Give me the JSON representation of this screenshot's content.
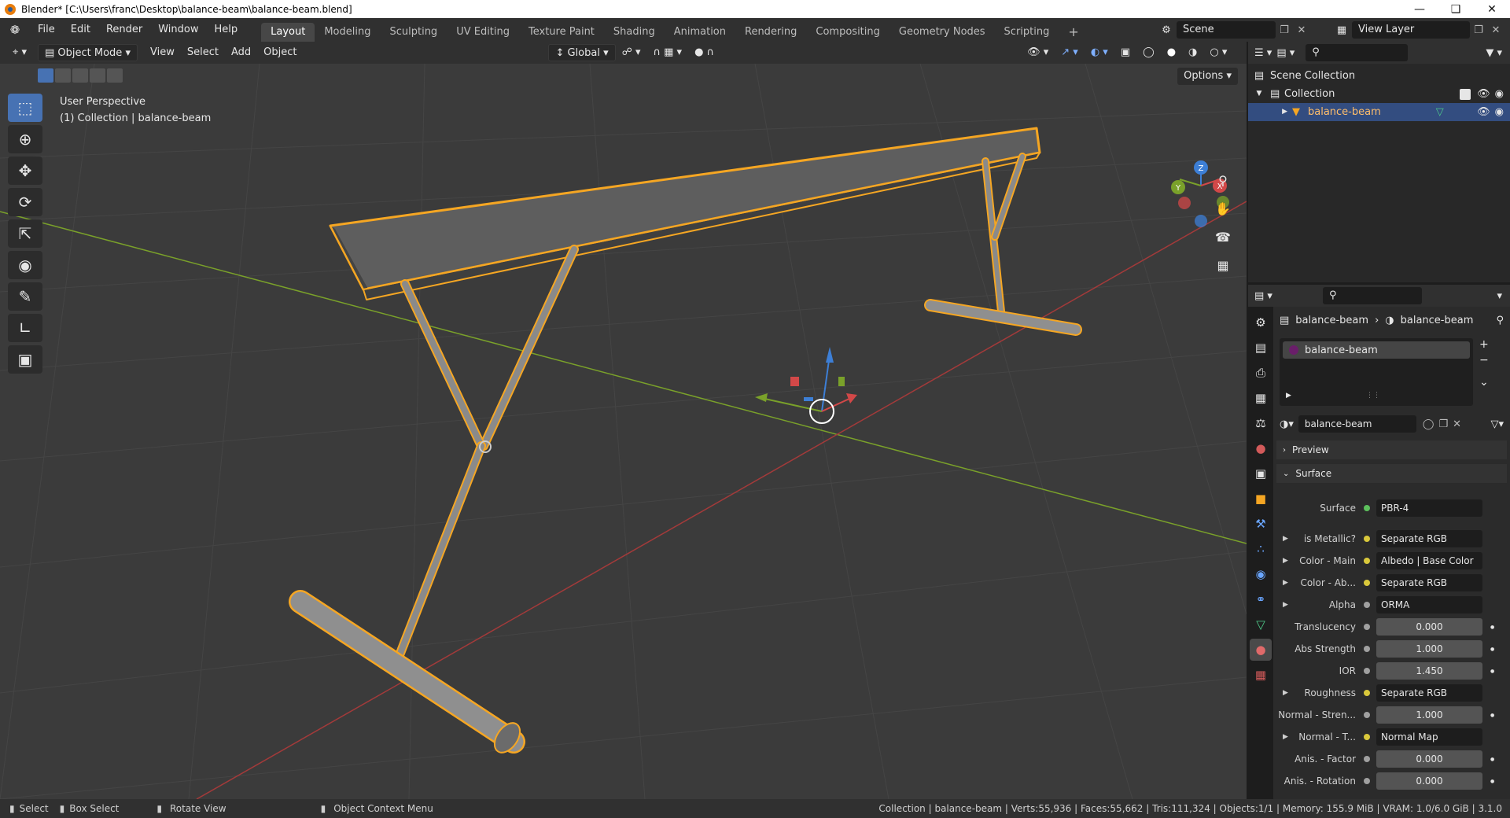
{
  "titlebar": {
    "title": "Blender* [C:\\Users\\franc\\Desktop\\balance-beam\\balance-beam.blend]"
  },
  "menus": [
    "File",
    "Edit",
    "Render",
    "Window",
    "Help"
  ],
  "workspaces": [
    "Layout",
    "Modeling",
    "Sculpting",
    "UV Editing",
    "Texture Paint",
    "Shading",
    "Animation",
    "Rendering",
    "Compositing",
    "Geometry Nodes",
    "Scripting"
  ],
  "scene": {
    "label": "Scene"
  },
  "view_layer": {
    "label": "View Layer"
  },
  "viewport_header": {
    "mode": "Object Mode",
    "menus": [
      "View",
      "Select",
      "Add",
      "Object"
    ],
    "transform_orientation": "Global"
  },
  "viewport": {
    "perspective_label": "User Perspective",
    "collection_label": "(1) Collection | balance-beam",
    "options_label": "Options",
    "gizmo_axes": [
      "X",
      "Y",
      "Z"
    ],
    "accent": "#f5a623"
  },
  "outliner": {
    "rows": [
      {
        "label": "Scene Collection"
      },
      {
        "label": "Collection"
      },
      {
        "label": "balance-beam"
      }
    ]
  },
  "properties": {
    "breadcrumb_object": "balance-beam",
    "breadcrumb_material": "balance-beam",
    "material_slot": "balance-beam",
    "material_name": "balance-beam",
    "panel_preview": "Preview",
    "panel_surface": "Surface",
    "rows": [
      {
        "label": "Surface",
        "value": "PBR-4",
        "socket": "#5cc05c",
        "type": "link"
      },
      {
        "label": "is Metallic?",
        "value": "Separate RGB",
        "socket": "#d9c83b",
        "type": "link"
      },
      {
        "label": "Color - Main",
        "value": "Albedo | Base Color",
        "socket": "#d9c83b",
        "type": "link"
      },
      {
        "label": "Color - Ab...",
        "value": "Separate RGB",
        "socket": "#d9c83b",
        "type": "link"
      },
      {
        "label": "Alpha",
        "value": "ORMA",
        "socket": "#a0a0a0",
        "type": "link"
      },
      {
        "label": "Translucency",
        "value": "0.000",
        "socket": "#a0a0a0",
        "type": "num"
      },
      {
        "label": "Abs Strength",
        "value": "1.000",
        "socket": "#a0a0a0",
        "type": "num"
      },
      {
        "label": "IOR",
        "value": "1.450",
        "socket": "#a0a0a0",
        "type": "num"
      },
      {
        "label": "Roughness",
        "value": "Separate RGB",
        "socket": "#d9c83b",
        "type": "link"
      },
      {
        "label": "Normal - Stren...",
        "value": "1.000",
        "socket": "#a0a0a0",
        "type": "num"
      },
      {
        "label": "Normal - T...",
        "value": "Normal Map",
        "socket": "#d9c83b",
        "type": "link"
      },
      {
        "label": "Anis. - Factor",
        "value": "0.000",
        "socket": "#a0a0a0",
        "type": "num"
      },
      {
        "label": "Anis. - Rotation",
        "value": "0.000",
        "socket": "#a0a0a0",
        "type": "num"
      }
    ]
  },
  "statusbar": {
    "select": "Select",
    "box_select": "Box Select",
    "rotate": "Rotate View",
    "context_menu": "Object Context Menu",
    "stats": "Collection | balance-beam | Verts:55,936 | Faces:55,662 | Tris:111,324 | Objects:1/1 | Memory: 155.9 MiB | VRAM: 1.0/6.0 GiB | 3.1.0"
  }
}
